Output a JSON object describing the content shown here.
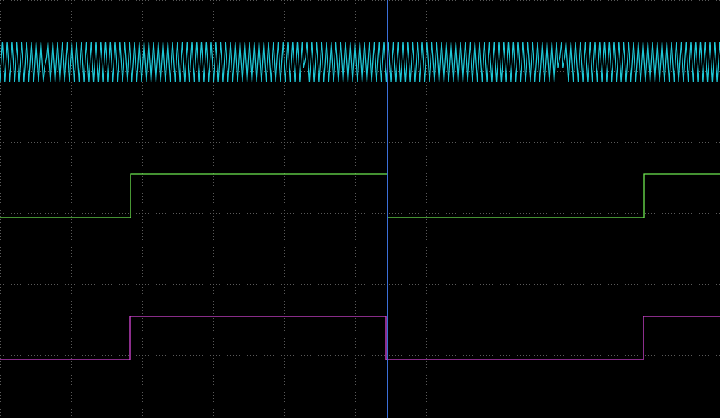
{
  "chart_data": {
    "type": "line",
    "title": "",
    "xlabel": "",
    "ylabel": "",
    "grid": true,
    "legend": "none",
    "x_divisions": 10,
    "y_divisions": 10,
    "x_range": [
      0,
      10.13
    ],
    "y_range": [
      -5.88,
      0
    ],
    "cursor": {
      "x": 5.45,
      "color": "#3b6fd8"
    },
    "background_color": "#000000",
    "grid_color": "#5a5a5a",
    "series": [
      {
        "key": "ch1-clock",
        "color": "#1ec8d8",
        "kind": "clock",
        "x_start": 0,
        "x_end": 10.13,
        "y_high": -0.59,
        "y_low": -1.15,
        "period": 0.0675,
        "glitch_x": [
          0.62,
          4.25,
          7.87
        ]
      },
      {
        "key": "ch2-square",
        "color": "#6ee850",
        "kind": "square",
        "y_high": -2.45,
        "y_low": -3.06,
        "points": [
          [
            0,
            "low"
          ],
          [
            1.84,
            "high"
          ],
          [
            5.45,
            "low"
          ],
          [
            9.06,
            "high"
          ],
          [
            10.13,
            "high"
          ]
        ]
      },
      {
        "key": "ch3-square",
        "color": "#d846d8",
        "kind": "square",
        "y_high": -4.45,
        "y_low": -5.06,
        "points": [
          [
            0,
            "low"
          ],
          [
            1.83,
            "high"
          ],
          [
            5.43,
            "low"
          ],
          [
            9.05,
            "high"
          ],
          [
            10.13,
            "high"
          ]
        ]
      }
    ]
  }
}
